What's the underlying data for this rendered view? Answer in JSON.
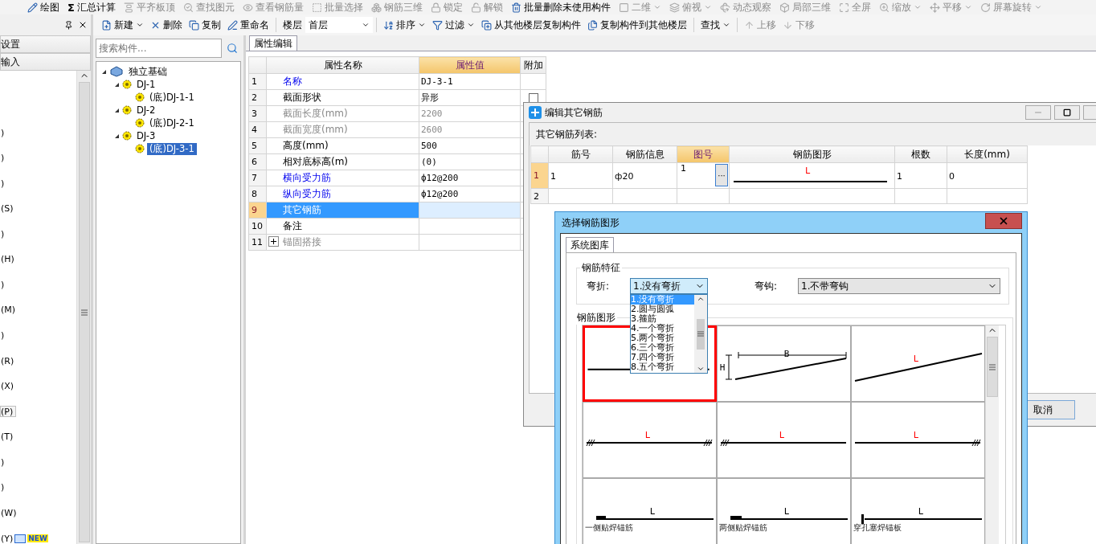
{
  "top_toolbar": {
    "items": [
      {
        "label": "绘图",
        "disabled": false,
        "dropdown": false
      },
      {
        "glyph": "Σ",
        "label": "汇总计算",
        "disabled": false,
        "dropdown": false
      },
      {
        "label": "平齐板顶",
        "disabled": true,
        "dropdown": false
      },
      {
        "label": "查找图元",
        "disabled": true,
        "dropdown": false
      },
      {
        "label": "查看钢筋量",
        "disabled": true,
        "dropdown": false
      },
      {
        "label": "批量选择",
        "disabled": true,
        "dropdown": false
      },
      {
        "label": "钢筋三维",
        "disabled": true,
        "dropdown": false
      },
      {
        "label": "锁定",
        "disabled": true,
        "dropdown": false
      },
      {
        "label": "解锁",
        "disabled": true,
        "dropdown": false
      },
      {
        "label": "批量删除未使用构件",
        "disabled": false,
        "dropdown": false
      },
      {
        "label": "二维",
        "disabled": true,
        "dropdown": true
      },
      {
        "label": "俯视",
        "disabled": true,
        "dropdown": true
      },
      {
        "label": "动态观察",
        "disabled": true,
        "dropdown": false
      },
      {
        "label": "局部三维",
        "disabled": true,
        "dropdown": false
      },
      {
        "label": "全屏",
        "disabled": true,
        "dropdown": false
      },
      {
        "label": "缩放",
        "disabled": true,
        "dropdown": true
      },
      {
        "label": "平移",
        "disabled": true,
        "dropdown": true
      },
      {
        "label": "屏幕旋转",
        "disabled": true,
        "dropdown": true
      }
    ]
  },
  "left_panel": {
    "sections": [
      {
        "label": "设置"
      },
      {
        "label": "输入"
      }
    ],
    "items": [
      {
        "text": ")",
        "selected": false
      },
      {
        "text": ")",
        "selected": false
      },
      {
        "text": ")",
        "selected": false
      },
      {
        "text": "(S)",
        "selected": false
      },
      {
        "text": ")",
        "selected": false
      },
      {
        "text": "(H)",
        "selected": false
      },
      {
        "text": ")",
        "selected": false
      },
      {
        "text": "(M)",
        "selected": false
      },
      {
        "text": ")",
        "selected": false
      },
      {
        "text": "(R)",
        "selected": false
      },
      {
        "text": "(X)",
        "selected": false
      },
      {
        "text": "(P)",
        "selected": true
      },
      {
        "text": "(T)",
        "selected": false
      },
      {
        "text": ")",
        "selected": false
      },
      {
        "text": ")",
        "selected": false
      },
      {
        "text": "(W)",
        "selected": false
      },
      {
        "text": "(Y)",
        "selected": false,
        "badge": "NEW"
      }
    ]
  },
  "component_toolbar": {
    "groups": [
      {
        "items": [
          {
            "kind": "button",
            "label": "新建",
            "dropdown": true,
            "disabled": false
          },
          {
            "kind": "button",
            "label": "删除",
            "dropdown": false,
            "disabled": false
          },
          {
            "kind": "button",
            "label": "复制",
            "dropdown": false,
            "disabled": false
          },
          {
            "kind": "button",
            "label": "重命名",
            "dropdown": false,
            "disabled": false
          }
        ]
      },
      {
        "items": [
          {
            "kind": "label",
            "label": "楼层"
          },
          {
            "kind": "select",
            "label": "首层"
          }
        ]
      },
      {
        "items": [
          {
            "kind": "button",
            "label": "排序",
            "dropdown": true,
            "disabled": false
          },
          {
            "kind": "button",
            "label": "过滤",
            "dropdown": true,
            "disabled": false
          },
          {
            "kind": "button",
            "label": "从其他楼层复制构件",
            "dropdown": false,
            "disabled": false
          },
          {
            "kind": "button",
            "label": "复制构件到其他楼层",
            "dropdown": false,
            "disabled": false
          }
        ]
      },
      {
        "items": [
          {
            "kind": "button",
            "label": "查找",
            "dropdown": true,
            "disabled": false
          }
        ]
      },
      {
        "items": [
          {
            "kind": "button",
            "label": "上移",
            "dropdown": false,
            "disabled": true
          },
          {
            "kind": "button",
            "label": "下移",
            "dropdown": false,
            "disabled": true
          }
        ]
      }
    ]
  },
  "component_tree": {
    "search": {
      "placeholder": "搜索构件..."
    },
    "nodes": [
      {
        "label": "独立基础",
        "expanded": true,
        "selected": false,
        "children": [
          {
            "label": "DJ-1",
            "expanded": true,
            "selected": false,
            "children": [
              {
                "label": "(底)DJ-1-1",
                "selected": false
              }
            ]
          },
          {
            "label": "DJ-2",
            "expanded": true,
            "selected": false,
            "children": [
              {
                "label": "(底)DJ-2-1",
                "selected": false
              }
            ]
          },
          {
            "label": "DJ-3",
            "expanded": true,
            "selected": false,
            "children": [
              {
                "label": "(底)DJ-3-1",
                "selected": true
              }
            ]
          }
        ]
      }
    ]
  },
  "property_editor": {
    "tab": "属性编辑",
    "columns": [
      {
        "label": "属性名称",
        "selected": false
      },
      {
        "label": "属性值",
        "selected": true
      },
      {
        "label": "附加",
        "selected": false
      }
    ],
    "rows": [
      {
        "num": "1",
        "name": "名称",
        "kind": "link",
        "value": "DJ-3-1",
        "selected": false
      },
      {
        "num": "2",
        "name": "截面形状",
        "kind": "normal",
        "value": "异形",
        "selected": false,
        "checked": false
      },
      {
        "num": "3",
        "name": "截面长度(mm)",
        "kind": "disabled",
        "value": "2200",
        "selected": false
      },
      {
        "num": "4",
        "name": "截面宽度(mm)",
        "kind": "disabled",
        "value": "2600",
        "selected": false
      },
      {
        "num": "5",
        "name": "高度(mm)",
        "kind": "normal",
        "value": "500",
        "selected": false
      },
      {
        "num": "6",
        "name": "相对底标高(m)",
        "kind": "normal",
        "value": "(0)",
        "selected": false
      },
      {
        "num": "7",
        "name": "横向受力筋",
        "kind": "link",
        "value": "ф12@200",
        "selected": false
      },
      {
        "num": "8",
        "name": "纵向受力筋",
        "kind": "link",
        "value": "ф12@200",
        "selected": false
      },
      {
        "num": "9",
        "name": "其它钢筋",
        "kind": "normal",
        "selected": true
      },
      {
        "num": "10",
        "name": "备注",
        "kind": "normal",
        "selected": false
      },
      {
        "num": "11",
        "name": "锚固搭接",
        "kind": "disabled",
        "selected": false,
        "expanded": false
      }
    ]
  },
  "edit_rebar_dialog": {
    "title": "编辑其它钢筋",
    "list_label": "其它钢筋列表:",
    "columns": [
      {
        "label": "筋号",
        "selected": false
      },
      {
        "label": "钢筋信息",
        "selected": false
      },
      {
        "label": "图号",
        "selected": true
      },
      {
        "label": "钢筋图形",
        "selected": false
      },
      {
        "label": "根数",
        "selected": false
      },
      {
        "label": "长度(mm)",
        "selected": false
      }
    ],
    "rows": [
      {
        "num": "1",
        "selected": true,
        "cells": [
          {
            "kind": "text",
            "text": "1"
          },
          {
            "kind": "text",
            "text": "ф20"
          },
          {
            "kind": "picker",
            "text": "1",
            "button": "···"
          },
          {
            "kind": "shape",
            "text": "L"
          },
          {
            "kind": "text",
            "text": "1"
          },
          {
            "kind": "text",
            "text": "0"
          }
        ]
      },
      {
        "num": "2",
        "selected": false
      }
    ],
    "buttons": [
      {
        "label": "取消"
      }
    ]
  },
  "shape_dialog": {
    "title": "选择钢筋图形",
    "tab": "系统图库",
    "features": {
      "title": "钢筋特征",
      "bend": {
        "label": "弯折:",
        "value": "1.没有弯折",
        "open": true,
        "options": [
          {
            "label": "1.没有弯折",
            "selected": true
          },
          {
            "label": "2.圆与圆弧",
            "selected": false
          },
          {
            "label": "3.箍筋",
            "selected": false
          },
          {
            "label": "4.一个弯折",
            "selected": false
          },
          {
            "label": "5.两个弯折",
            "selected": false
          },
          {
            "label": "6.三个弯折",
            "selected": false
          },
          {
            "label": "7.四个弯折",
            "selected": false
          },
          {
            "label": "8.五个弯折",
            "selected": false
          }
        ]
      },
      "hook": {
        "label": "弯钩:",
        "value": "1.不带弯钩"
      }
    },
    "shapes_title": "钢筋图形",
    "shapes": [
      {
        "kind": "straight",
        "selected": true
      },
      {
        "kind": "sloped-dimensioned",
        "selected": false,
        "labels": [
          "B",
          "H"
        ]
      },
      {
        "kind": "sloped",
        "selected": false,
        "labels": [
          "L"
        ]
      },
      {
        "kind": "anchored-both",
        "selected": false,
        "labels": [
          "L"
        ]
      },
      {
        "kind": "anchored-left",
        "selected": false,
        "labels": [
          "L"
        ]
      },
      {
        "kind": "anchored-right",
        "selected": false,
        "labels": [
          "L"
        ]
      },
      {
        "kind": "weld-one",
        "selected": false,
        "labels": [
          "L"
        ],
        "caption": "一侧贴焊锚筋"
      },
      {
        "kind": "weld-two",
        "selected": false,
        "labels": [
          "L"
        ],
        "caption": "两侧贴焊锚筋"
      },
      {
        "kind": "plug-weld",
        "selected": false,
        "labels": [
          "L"
        ],
        "caption": "穿孔塞焊锚板"
      }
    ]
  }
}
